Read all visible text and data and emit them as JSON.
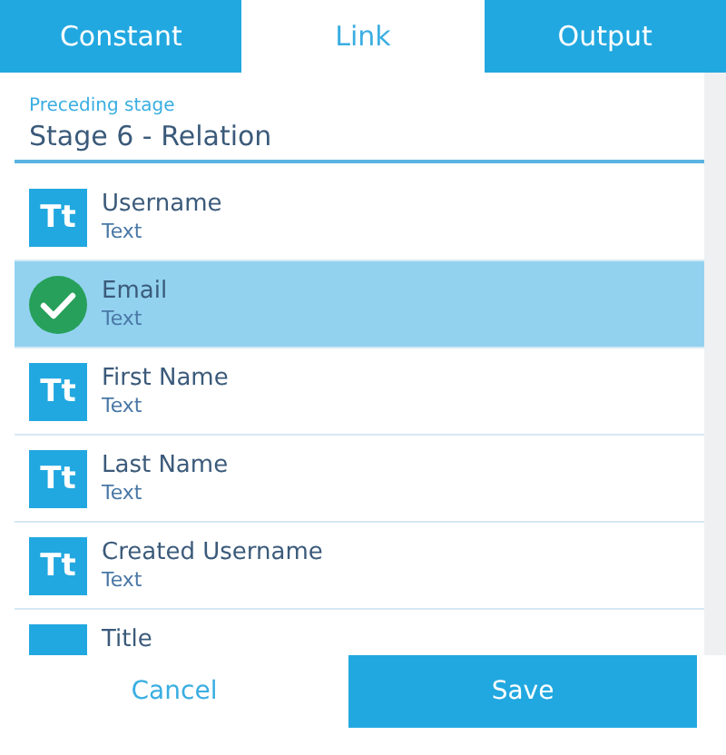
{
  "tabs": [
    {
      "label": "Constant",
      "selected": false
    },
    {
      "label": "Link",
      "selected": true
    },
    {
      "label": "Output",
      "selected": false
    }
  ],
  "field": {
    "label": "Preceding stage",
    "value": "Stage 6 - Relation"
  },
  "items": [
    {
      "icon": "Tt",
      "name": "Username",
      "type": "Text",
      "selected": false
    },
    {
      "name": "Email",
      "type": "Text",
      "selected": true
    },
    {
      "icon": "Tt",
      "name": "First Name",
      "type": "Text",
      "selected": false
    },
    {
      "icon": "Tt",
      "name": "Last Name",
      "type": "Text",
      "selected": false
    },
    {
      "icon": "Tt",
      "name": "Created Username",
      "type": "Text",
      "selected": false
    },
    {
      "name": "Title",
      "selected": false
    }
  ],
  "buttons": {
    "cancel": "Cancel",
    "save": "Save"
  }
}
